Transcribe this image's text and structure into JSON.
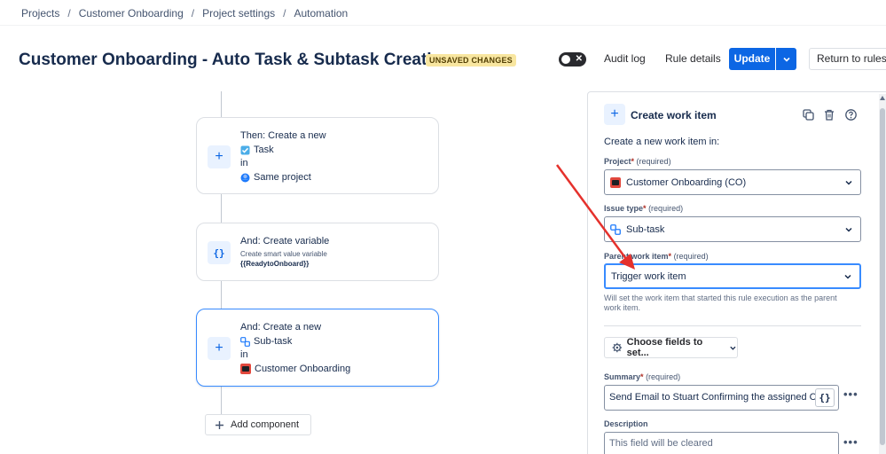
{
  "breadcrumb": [
    "Projects",
    "Customer Onboarding",
    "Project settings",
    "Automation"
  ],
  "header": {
    "title": "Customer Onboarding - Auto Task & Subtask Creation",
    "badge": "UNSAVED CHANGES",
    "audit_log": "Audit log",
    "rule_details": "Rule details",
    "update": "Update",
    "return": "Return to rules"
  },
  "flow": {
    "card1": {
      "line1": "Then: Create a new",
      "type": "Task",
      "in": "in",
      "project": "Same project"
    },
    "card2": {
      "line1": "And: Create variable",
      "sub": "Create smart value variable",
      "var": "{{ReadytoOnboard}}"
    },
    "card3": {
      "line1": "And: Create a new",
      "type": "Sub-task",
      "in": "in",
      "project": "Customer Onboarding"
    },
    "add_component": "Add component"
  },
  "panel": {
    "title": "Create work item",
    "intro": "Create a new work item in:",
    "project_label": "Project",
    "issue_type_label": "Issue type",
    "parent_label": "Parent work item",
    "required_text": "(required)",
    "project_value": "Customer Onboarding (CO)",
    "issue_type_value": "Sub-task",
    "parent_value": "Trigger work item",
    "parent_help": "Will set the work item that started this rule execution as the parent work item.",
    "choose_fields": "Choose fields to set...",
    "summary_label": "Summary",
    "summary_value": "Send Email to Stuart Confirming the assigned Cu",
    "smart_value_btn": "{}",
    "description_label": "Description",
    "description_placeholder": "This field will be cleared"
  },
  "colors": {
    "accent": "#0c66e4",
    "badge_bg": "#f8e6a0",
    "arrow": "#e5312c"
  }
}
